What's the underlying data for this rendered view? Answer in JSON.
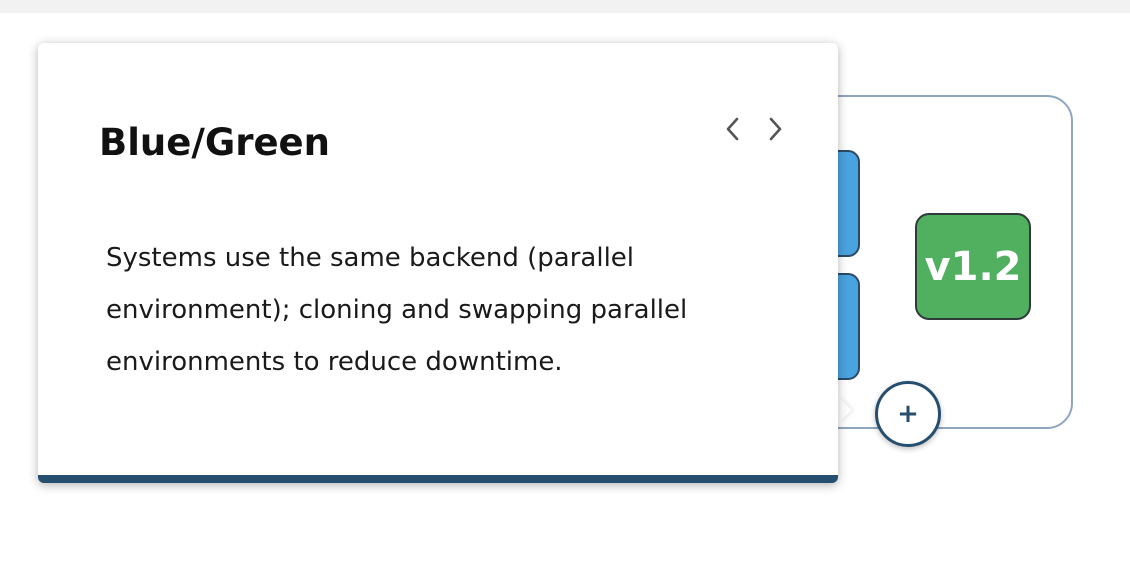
{
  "popover": {
    "title": "Blue/Green",
    "description": "Systems use the same backend (parallel environment); cloning and swapping parallel environments to reduce downtime.",
    "nav": {
      "prev_icon": "chevron-left-icon",
      "next_icon": "chevron-right-icon"
    }
  },
  "diagram": {
    "version_label": "v1.2",
    "add_label": "+"
  },
  "colors": {
    "accent": "#264e6e",
    "blue_block": "#4aa3df",
    "version_green": "#50b060",
    "frame_border": "#8fa6bf"
  }
}
